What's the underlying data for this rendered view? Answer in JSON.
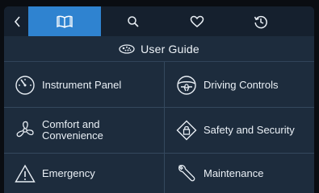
{
  "nav": {
    "back_icon": "chevron-left-icon",
    "tabs": [
      {
        "icon": "open-book-icon",
        "active": true
      },
      {
        "icon": "search-icon",
        "active": false
      },
      {
        "icon": "heart-icon",
        "active": false
      },
      {
        "icon": "history-icon",
        "active": false
      }
    ]
  },
  "header": {
    "brand_icon": "brand-logo-icon",
    "title": "User Guide"
  },
  "menu": {
    "items": [
      {
        "label": "Instrument Panel",
        "icon": "gauge-icon"
      },
      {
        "label": "Driving Controls",
        "icon": "steering-wheel-icon"
      },
      {
        "label": "Comfort and\nConvenience",
        "icon": "fan-icon"
      },
      {
        "label": "Safety and Security",
        "icon": "lock-diamond-icon"
      },
      {
        "label": "Emergency",
        "icon": "warning-triangle-icon"
      },
      {
        "label": "Maintenance",
        "icon": "wrench-icon"
      }
    ]
  },
  "colors": {
    "background": "#1d2c3d",
    "topbar": "#15202e",
    "active_tab": "#2f83d0",
    "divider": "#34485e",
    "text": "#eef3f8"
  }
}
